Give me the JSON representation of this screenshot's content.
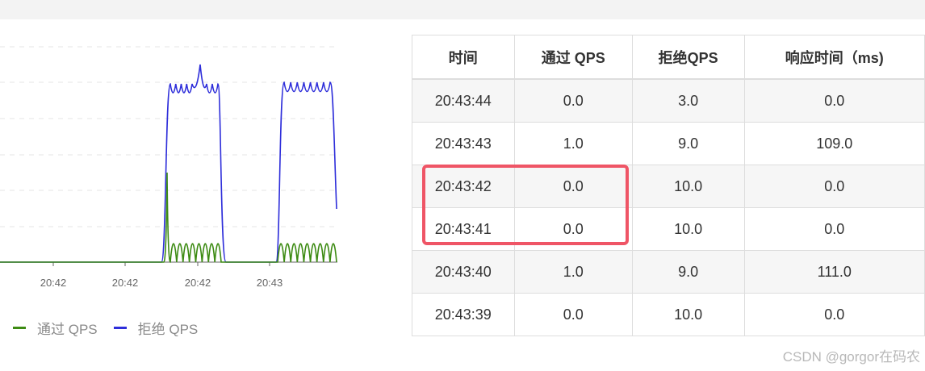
{
  "colors": {
    "pass_series": "#3d8b13",
    "block_series": "#2e2eda",
    "highlight": "#ef5566",
    "grid": "#e5e5e5"
  },
  "chart_data": {
    "type": "line",
    "x_ticks": [
      "20:42",
      "20:42",
      "20:42",
      "20:43"
    ],
    "series": [
      {
        "name": "通过 QPS",
        "color": "#3d8b13"
      },
      {
        "name": "拒绝 QPS",
        "color": "#2e2eda"
      }
    ],
    "grid": true,
    "legend_position": "bottom-left"
  },
  "legend": {
    "pass_label": "通过 QPS",
    "block_label": "拒绝 QPS"
  },
  "table": {
    "headers": {
      "time": "时间",
      "pass": "通过 QPS",
      "block": "拒绝QPS",
      "rt": "响应时间（ms)"
    },
    "rows": [
      {
        "time": "20:43:44",
        "pass": "0.0",
        "block": "3.0",
        "rt": "0.0"
      },
      {
        "time": "20:43:43",
        "pass": "1.0",
        "block": "9.0",
        "rt": "109.0"
      },
      {
        "time": "20:43:42",
        "pass": "0.0",
        "block": "10.0",
        "rt": "0.0"
      },
      {
        "time": "20:43:41",
        "pass": "0.0",
        "block": "10.0",
        "rt": "0.0"
      },
      {
        "time": "20:43:40",
        "pass": "1.0",
        "block": "9.0",
        "rt": "111.0"
      },
      {
        "time": "20:43:39",
        "pass": "0.0",
        "block": "10.0",
        "rt": "0.0"
      }
    ]
  },
  "watermark": "CSDN @gorgor在码农"
}
